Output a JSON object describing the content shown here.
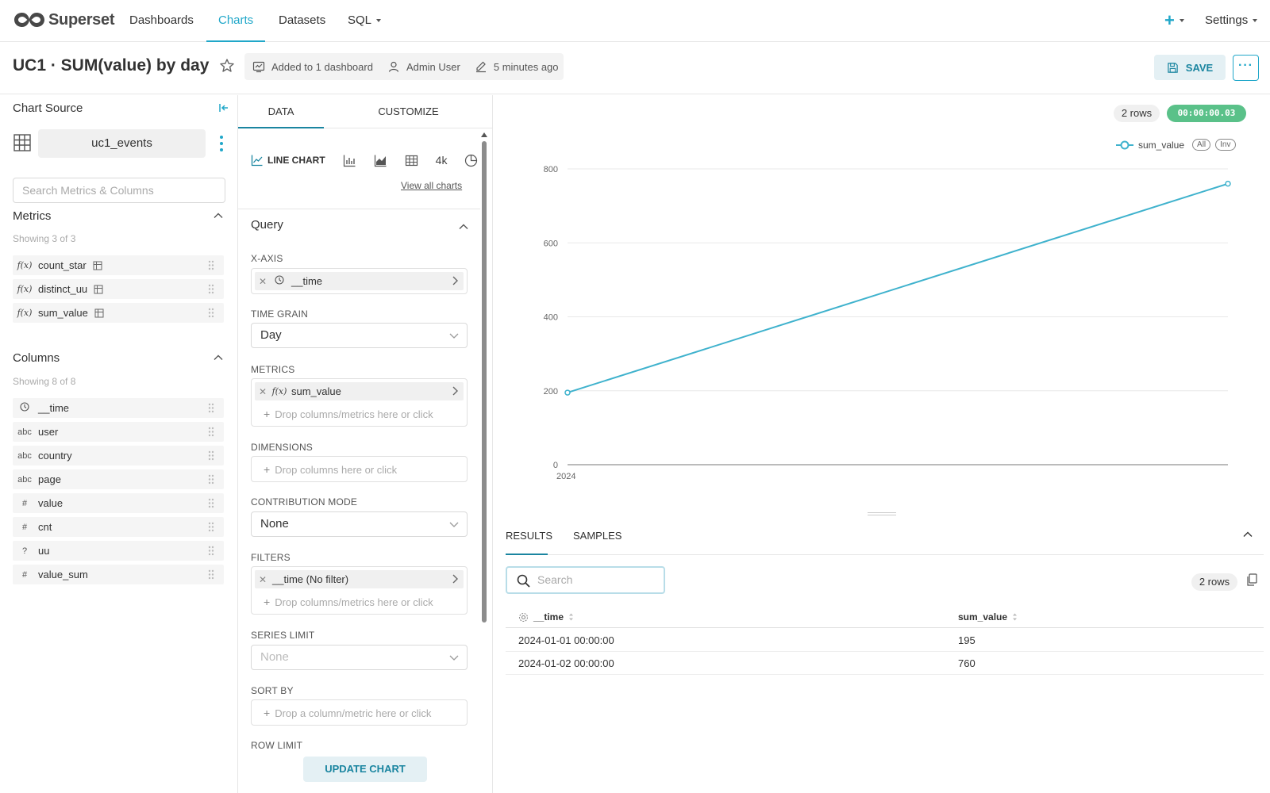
{
  "nav": {
    "brand": "Superset",
    "items": [
      "Dashboards",
      "Charts",
      "Datasets",
      "SQL"
    ],
    "settings": "Settings"
  },
  "titlebar": {
    "title": "UC1 · SUM(value) by day",
    "meta": [
      "Added to 1 dashboard",
      "Admin User",
      "5 minutes ago"
    ],
    "save_label": "SAVE",
    "more_label": "···"
  },
  "sidebar": {
    "title": "Chart Source",
    "dataset": "uc1_events",
    "search_placeholder": "Search Metrics & Columns",
    "metrics_head": "Metrics",
    "metrics_count": "Showing 3 of 3",
    "metrics": [
      {
        "icon": "f(x)",
        "name": "count_star"
      },
      {
        "icon": "f(x)",
        "name": "distinct_uu"
      },
      {
        "icon": "f(x)",
        "name": "sum_value"
      }
    ],
    "columns_head": "Columns",
    "columns_count": "Showing 8 of 8",
    "columns": [
      {
        "icon": "clock-icon",
        "name": "__time"
      },
      {
        "icon": "abc",
        "name": "user"
      },
      {
        "icon": "abc",
        "name": "country"
      },
      {
        "icon": "abc",
        "name": "page"
      },
      {
        "icon": "#",
        "name": "value"
      },
      {
        "icon": "#",
        "name": "cnt"
      },
      {
        "icon": "?",
        "name": "uu"
      },
      {
        "icon": "#",
        "name": "value_sum"
      }
    ]
  },
  "controls": {
    "tab_data": "DATA",
    "tab_customize": "CUSTOMIZE",
    "viz_active": "LINE CHART",
    "viz_4k": "4k",
    "view_all": "View all charts",
    "query_head": "Query",
    "xaxis_label": "X-AXIS",
    "xaxis_value": "__time",
    "timegrain_label": "TIME GRAIN",
    "timegrain_value": "Day",
    "metrics_label": "METRICS",
    "metrics_value": "sum_value",
    "drop_metrics": "Drop columns/metrics here or click",
    "dimensions_label": "DIMENSIONS",
    "drop_columns": "Drop columns here or click",
    "contribution_label": "CONTRIBUTION MODE",
    "contribution_value": "None",
    "filters_label": "FILTERS",
    "filters_value": "__time (No filter)",
    "drop_filters": "Drop columns/metrics here or click",
    "series_limit_label": "SERIES LIMIT",
    "series_limit_value": "None",
    "sort_by_label": "SORT BY",
    "drop_sort": "Drop a column/metric here or click",
    "row_limit_label": "ROW LIMIT",
    "update_label": "UPDATE CHART"
  },
  "chart_panel": {
    "rows_badge": "2 rows",
    "time_badge": "00:00:00.03",
    "legend_all": "All",
    "legend_inv": "Inv"
  },
  "chart_data": {
    "type": "line",
    "x": [
      "2024"
    ],
    "series": [
      {
        "name": "sum_value",
        "values": [
          195,
          760
        ]
      }
    ],
    "y_ticks": [
      0,
      200,
      400,
      600,
      800
    ],
    "ylim": [
      0,
      800
    ],
    "grid": true,
    "legend": "top-right",
    "color": "#3fb2cd"
  },
  "results": {
    "tab_results": "RESULTS",
    "tab_samples": "SAMPLES",
    "search_placeholder": "Search",
    "rows_badge": "2 rows",
    "headers": [
      "__time",
      "sum_value"
    ],
    "rows": [
      [
        "2024-01-01 00:00:00",
        "195"
      ],
      [
        "2024-01-02 00:00:00",
        "760"
      ]
    ]
  }
}
